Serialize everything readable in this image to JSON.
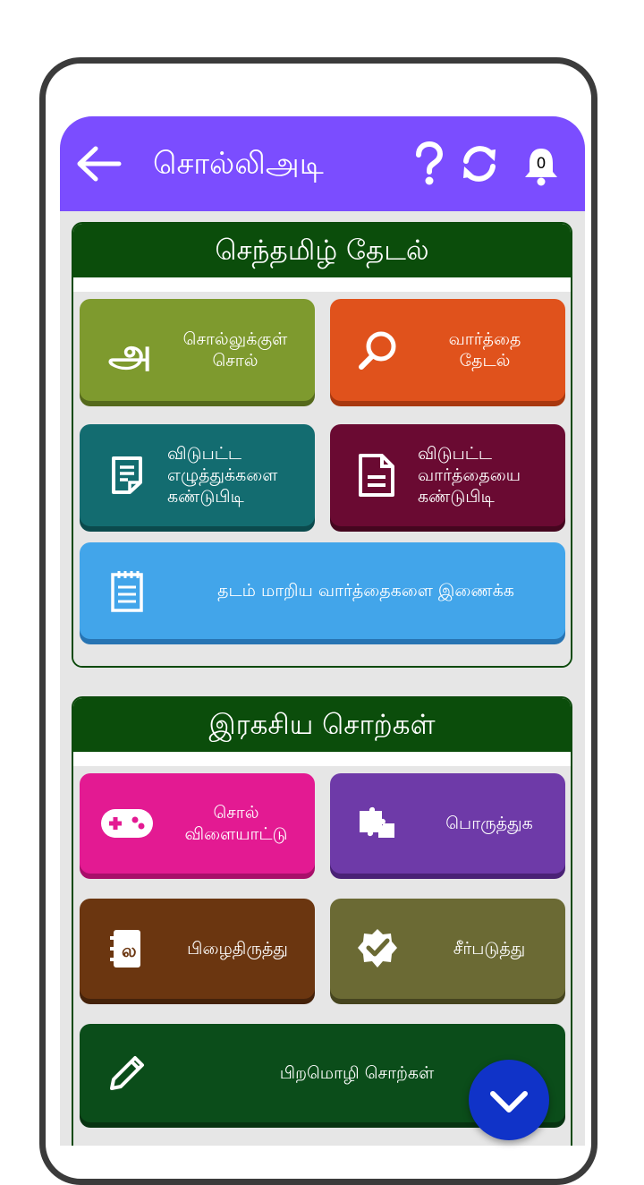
{
  "app": {
    "title": "சொல்லிஅடி",
    "notification_count": "0"
  },
  "icons": {
    "back": "arrow-left-icon",
    "help": "question-mark-icon",
    "refresh": "refresh-icon",
    "bell": "bell-icon",
    "fab": "chevron-down-icon"
  },
  "sections": [
    {
      "title": "செந்தமிழ் தேடல்",
      "tiles": [
        {
          "label": "சொல்லுக்குள்\nசொல்",
          "icon": "tamil-letter-icon",
          "color": "#7e9a2e"
        },
        {
          "label": "வார்த்தை\nதேடல்",
          "icon": "search-icon",
          "color": "#e0521c"
        },
        {
          "label": "விடுபட்ட\nஎழுத்துக்களை\nகண்டுபிடி",
          "icon": "note-icon",
          "color": "#136c70"
        },
        {
          "label": "விடுபட்ட\nவார்த்தையை\nகண்டுபிடி",
          "icon": "document-icon",
          "color": "#6a0a32"
        },
        {
          "label": "தடம் மாறிய வார்த்தைகளை இணைக்க",
          "icon": "notepad-icon",
          "color": "#42a5ea"
        }
      ]
    },
    {
      "title": "இரகசிய சொற்கள்",
      "tiles": [
        {
          "label": "சொல்\nவிளையாட்டு",
          "icon": "gamepad-icon",
          "color": "#e31a92"
        },
        {
          "label": "பொருத்துக",
          "icon": "puzzle-icon",
          "color": "#6e3aa8"
        },
        {
          "label": "பிழைதிருத்து",
          "icon": "book-icon",
          "color": "#6b3610"
        },
        {
          "label": "சீர்படுத்து",
          "icon": "badge-check-icon",
          "color": "#6b6a34"
        },
        {
          "label": "பிறமொழி சொற்கள்",
          "icon": "pencil-icon",
          "color": "#0b4d1a"
        }
      ]
    }
  ]
}
